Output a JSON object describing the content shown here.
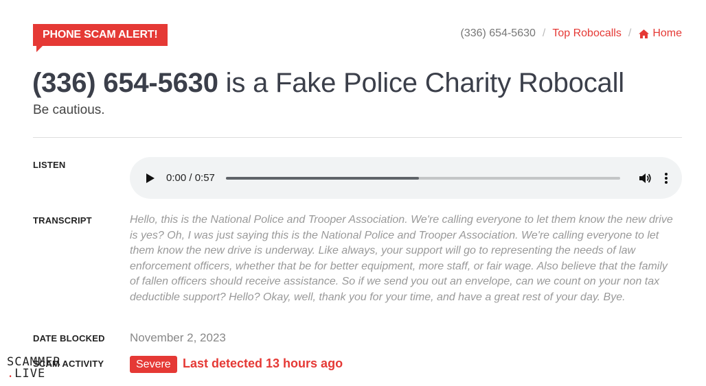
{
  "alert_badge": "PHONE SCAM ALERT!",
  "breadcrumb": {
    "current": "(336) 654-5630",
    "separator": "/",
    "top_robocalls": "Top Robocalls",
    "home": "Home",
    "home_icon": "home-icon"
  },
  "header": {
    "phone": "(336) 654-5630",
    "title_rest": " is a Fake Police Charity Robocall",
    "subtitle": "Be cautious."
  },
  "labels": {
    "listen": "LISTEN",
    "transcript": "TRANSCRIPT",
    "date_blocked": "DATE BLOCKED",
    "scam_activity": "SCAM ACTIVITY"
  },
  "audio": {
    "time": "0:00 / 0:57",
    "progress_fraction": 0.49
  },
  "transcript": "Hello, this is the National Police and Trooper Association. We're calling everyone to let them know the new drive is yes? Oh, I was just saying this is the National Police and Trooper Association. We're calling everyone to let them know the new drive is underway. Like always, your support will go to representing the needs of law enforcement officers, whether that be for better equipment, more staff, or fair wage. Also believe that the family of fallen officers should receive assistance. So if we send you out an envelope, can we count on your non tax deductible support? Hello? Okay, well, thank you for your time, and have a great rest of your day. Bye.",
  "date_blocked": "November 2, 2023",
  "scam_activity": {
    "severity": "Severe",
    "last_detected": "Last detected 13 hours ago"
  },
  "watermark": {
    "line1": "SCAMMER",
    "dot": ".",
    "line2": "LIVE"
  },
  "colors": {
    "accent": "#e53935",
    "player_bg": "#f1f3f4"
  }
}
